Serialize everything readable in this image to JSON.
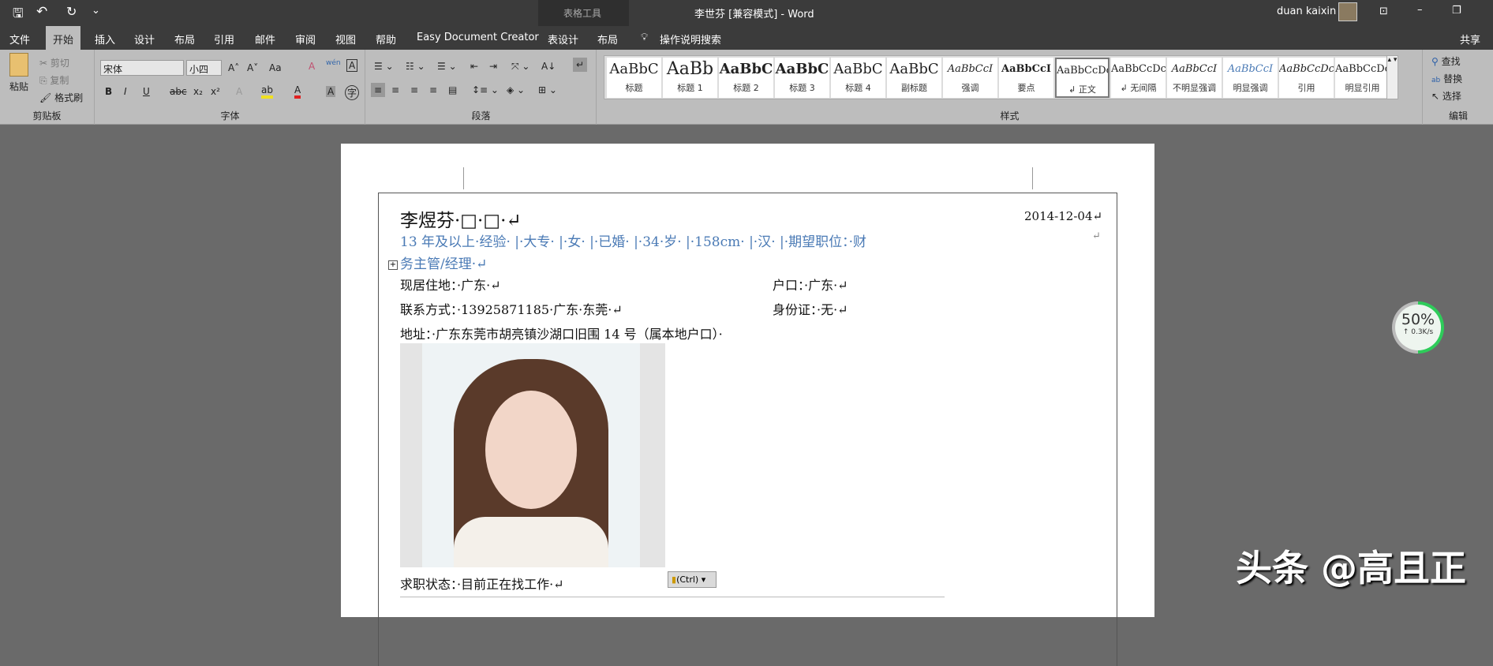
{
  "window": {
    "title": "李世芬 [兼容模式]  -  Word",
    "context_group": "表格工具",
    "user": "duan kaixin"
  },
  "qat": {
    "save": "🖫",
    "undo": "↶",
    "redo": "↻",
    "more": "⌄"
  },
  "tabs": [
    "文件",
    "开始",
    "插入",
    "设计",
    "布局",
    "引用",
    "邮件",
    "审阅",
    "视图",
    "帮助",
    "Easy Document Creator",
    "表设计",
    "布局"
  ],
  "tell_me": "操作说明搜索",
  "share": "共享",
  "clipboard": {
    "paste": "粘贴",
    "cut": "剪切",
    "copy": "复制",
    "format_painter": "格式刷",
    "label": "剪贴板"
  },
  "font": {
    "name": "宋体",
    "size": "小四",
    "label": "字体",
    "bold": "B",
    "italic": "I",
    "underline": "U",
    "strike": "abc",
    "sub": "x₂",
    "sup": "x²",
    "grow": "A˄",
    "shrink": "A˅",
    "case": "Aa",
    "clear": "A",
    "phonetic": "wén",
    "border": "A",
    "effect": "A",
    "highlight": "ab",
    "color": "A",
    "shade": "A",
    "enclose": "字"
  },
  "paragraph": {
    "label": "段落"
  },
  "styles": {
    "label": "样式",
    "items": [
      {
        "preview": "AaBbC",
        "name": "标题"
      },
      {
        "preview": "AaBb",
        "name": "标题 1"
      },
      {
        "preview": "AaBbC",
        "name": "标题 2"
      },
      {
        "preview": "AaBbC",
        "name": "标题 3"
      },
      {
        "preview": "AaBbC",
        "name": "标题 4"
      },
      {
        "preview": "AaBbC",
        "name": "副标题"
      },
      {
        "preview": "AaBbCcI",
        "name": "强调"
      },
      {
        "preview": "AaBbCcI",
        "name": "要点"
      },
      {
        "preview": "AaBbCcDc",
        "name": "↲ 正文"
      },
      {
        "preview": "AaBbCcDc",
        "name": "↲ 无间隔"
      },
      {
        "preview": "AaBbCcI",
        "name": "不明显强调"
      },
      {
        "preview": "AaBbCcI",
        "name": "明显强调"
      },
      {
        "preview": "AaBbCcDc",
        "name": "引用"
      },
      {
        "preview": "AaBbCcDc",
        "name": "明显引用"
      }
    ]
  },
  "editing": {
    "find": "查找",
    "replace": "替换",
    "select": "选择",
    "label": "编辑"
  },
  "doc": {
    "name": "李煜芬·□·□·↵",
    "date": "2014-12-04↵",
    "ret": "↵",
    "summary1": "13 年及以上·经验· |·大专· |·女· |·已婚· |·34·岁· |·158cm· |·汉· |·期望职位：·财",
    "summary2": "务主管/经理·↵",
    "residence": "现居住地：·广东·↵",
    "hukou": "户口：·广东·↵",
    "contact": "联系方式：·13925871185·广东·东莞·↵",
    "id": "身份证：·无·↵",
    "address": "地址：·广东东莞市胡亮镇沙湖口旧围 14 号（属本地户口）·",
    "status": "求职状态：·目前正在找工作·↵",
    "paste_options": "(Ctrl)"
  },
  "widget": {
    "percent": "50%",
    "speed": "↑ 0.3K/s",
    "progress": 0.5
  },
  "watermark": "头条 @高且正"
}
